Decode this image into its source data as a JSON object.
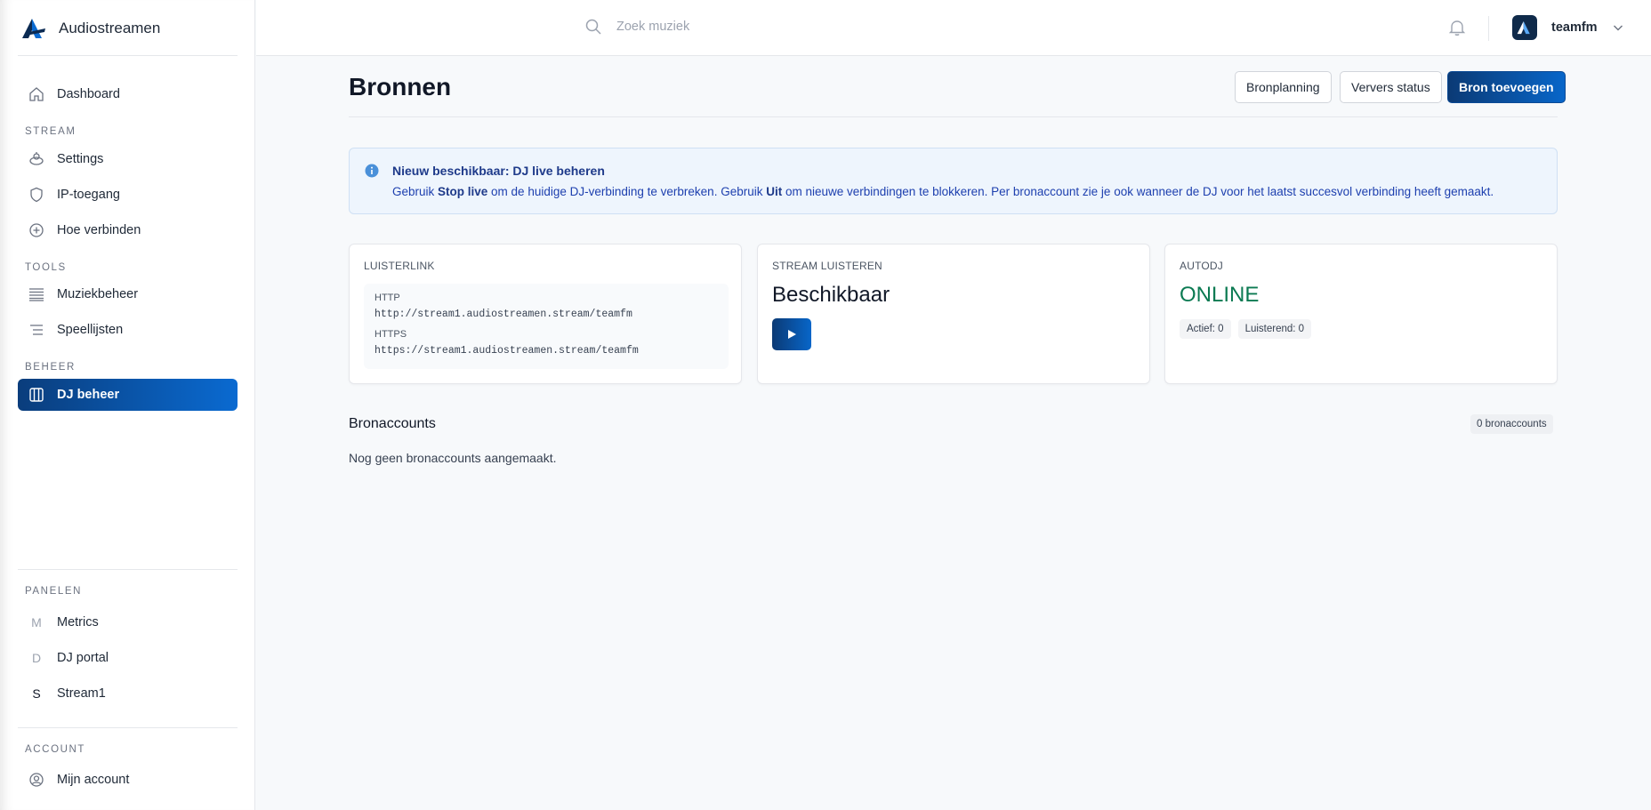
{
  "brand": {
    "name": "Audiostreamen"
  },
  "sidebar": {
    "dashboard": "Dashboard",
    "sections": {
      "stream": "STREAM",
      "tools": "TOOLS",
      "beheer": "BEHEER",
      "panelen": "PANELEN",
      "account": "ACCOUNT"
    },
    "stream_items": [
      "Settings",
      "IP-toegang",
      "Hoe verbinden"
    ],
    "tools_items": [
      "Muziekbeheer",
      "Speellijsten"
    ],
    "beheer_items": [
      "DJ beheer"
    ],
    "panel_items": [
      {
        "letter": "M",
        "label": "Metrics"
      },
      {
        "letter": "D",
        "label": "DJ portal"
      },
      {
        "letter": "S",
        "label": "Stream1"
      }
    ],
    "account_items": [
      "Mijn account"
    ],
    "active": "DJ beheer"
  },
  "topbar": {
    "search_placeholder": "Zoek muziek",
    "username": "teamfm"
  },
  "page": {
    "title": "Bronnen",
    "buttons": {
      "planning": "Bronplanning",
      "refresh": "Ververs status",
      "add": "Bron toevoegen"
    }
  },
  "info": {
    "title": "Nieuw beschikbaar: DJ live beheren",
    "body_1": "Gebruik ",
    "stop_live": "Stop live",
    "body_2": " om de huidige DJ-verbinding te verbreken. Gebruik ",
    "uit": "Uit",
    "body_3": " om nieuwe verbindingen te blokkeren. Per bronaccount zie je ook wanneer de DJ voor het laatst succesvol verbinding heeft gemaakt."
  },
  "cards": {
    "listen_link": {
      "label": "LUISTERLINK",
      "http_label": "HTTP",
      "http_url": "http://stream1.audiostreamen.stream/teamfm",
      "https_label": "HTTPS",
      "https_url": "https://stream1.audiostreamen.stream/teamfm"
    },
    "stream": {
      "label": "STREAM LUISTEREN",
      "status": "Beschikbaar"
    },
    "autodj": {
      "label": "AUTODJ",
      "status": "ONLINE",
      "active": "Actief: 0",
      "listening": "Luisterend: 0"
    }
  },
  "sources": {
    "title": "Bronaccounts",
    "count": "0 bronaccounts",
    "empty": "Nog geen bronaccounts aangemaakt."
  },
  "colors": {
    "accent": "#0866c9",
    "accent_dark": "#0b3a75",
    "online": "#0b7a52",
    "info_bg": "#eef5fd"
  }
}
